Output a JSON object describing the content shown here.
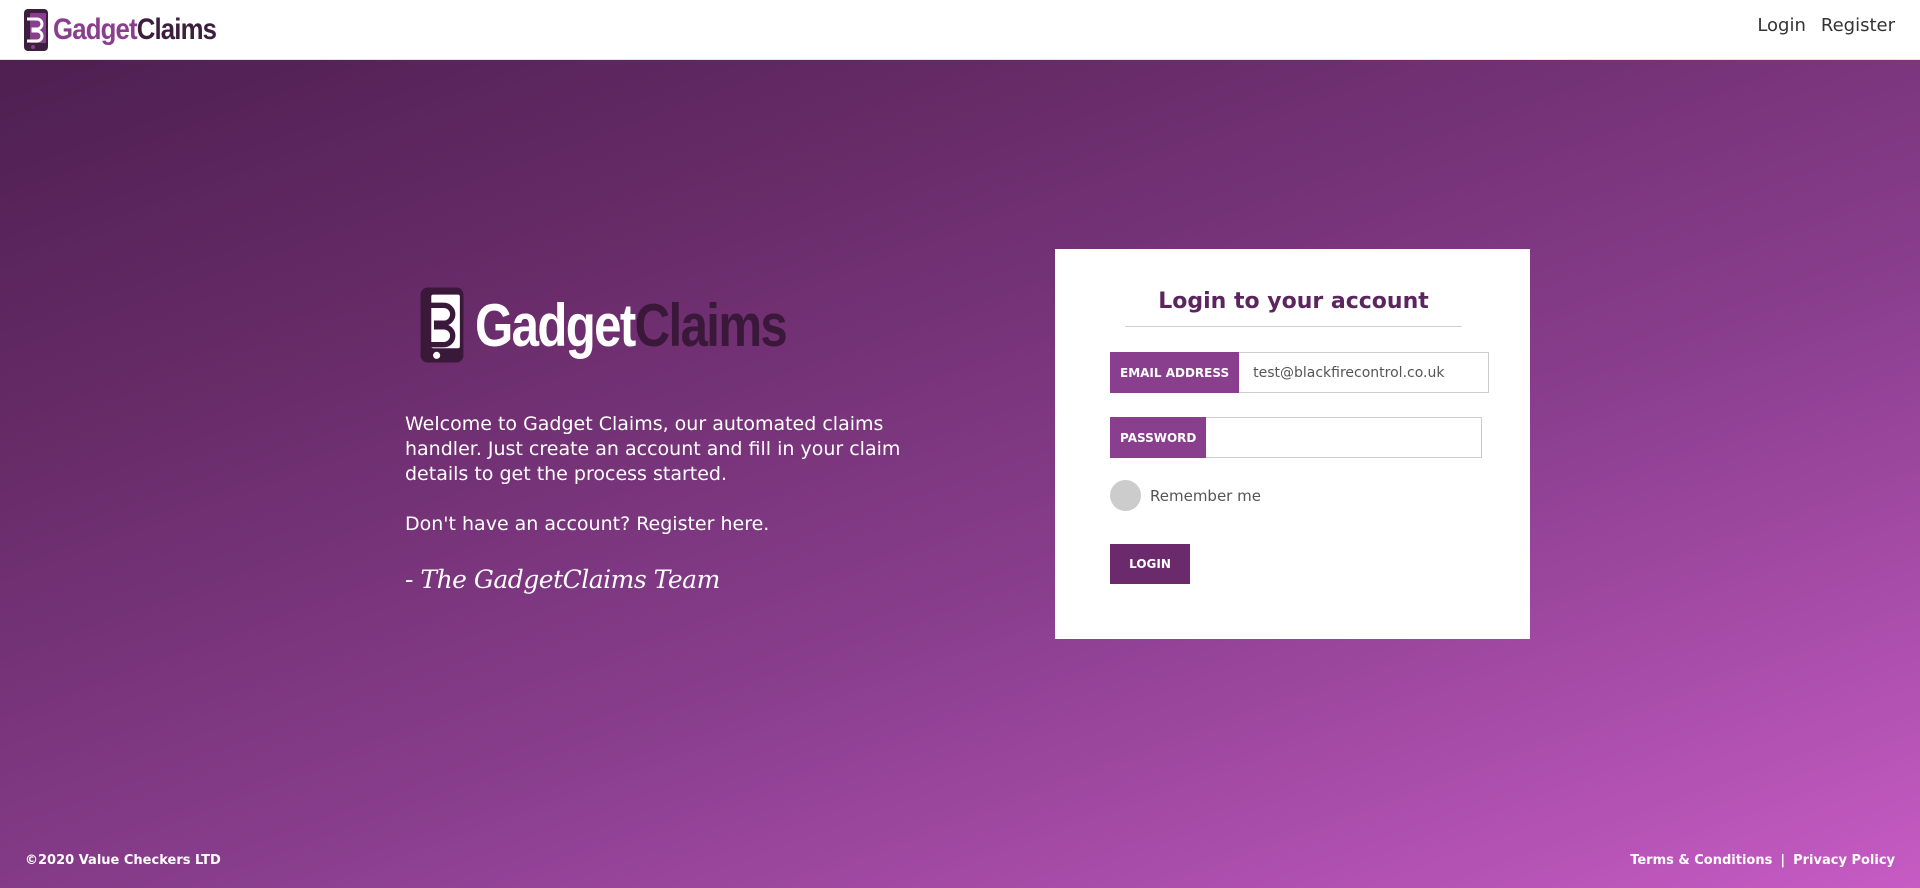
{
  "header": {
    "brand_part1": "Gadget",
    "brand_part2": "Claims",
    "nav": {
      "login": "Login",
      "register": "Register"
    }
  },
  "hero": {
    "logo_part1": "Gadget",
    "logo_part2": "Claims",
    "welcome_text": "Welcome to Gadget Claims, our automated claims handler. Just create an account and fill in your claim details to get the process started.",
    "register_text": "Don't have an account? Register here.",
    "signature": "- The GadgetClaims Team"
  },
  "login_form": {
    "title": "Login to your account",
    "email_label": "EMAIL ADDRESS",
    "email_value": "test@blackfirecontrol.co.uk",
    "password_label": "PASSWORD",
    "password_value": "",
    "remember_label": "Remember me",
    "submit_label": "LOGIN"
  },
  "footer": {
    "copyright": "©2020 Value Checkers LTD",
    "terms": "Terms & Conditions",
    "separator": "|",
    "privacy": "Privacy Policy"
  },
  "colors": {
    "brand_purple": "#8a3e8e",
    "brand_dark": "#3c1f3e",
    "button": "#6b2a6b"
  },
  "icons": {
    "brand": "phone-wrench-icon"
  }
}
